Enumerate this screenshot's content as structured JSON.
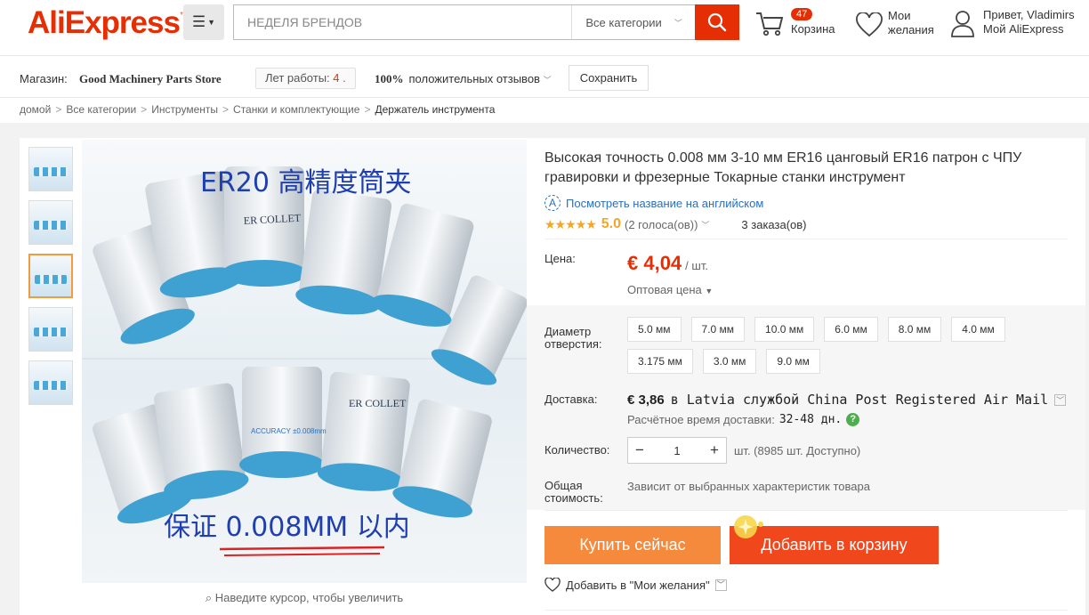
{
  "header": {
    "logo": "AliExpress",
    "logo_tm": "™",
    "search_placeholder": "НЕДЕЛЯ БРЕНДОВ",
    "category": "Все категории",
    "cart_count": "47",
    "cart_label": "Корзина",
    "wishlist_line1": "Мои",
    "wishlist_line2": "желания",
    "greeting": "Привет, Vladimirs",
    "my_account": "Мой AliExpress"
  },
  "store": {
    "label": "Магазин:",
    "name": "Good Machinery Parts Store",
    "years_label": "Лет работы:",
    "years_value": "4 .",
    "positive_percent": "100%",
    "positive_label": "положительных отзывов",
    "save_label": "Сохранить"
  },
  "breadcrumb": [
    "домой",
    "Все категории",
    "Инструменты",
    "Станки и комплектующие",
    "Держатель инструмента"
  ],
  "gallery": {
    "zoom_hint": "Наведите курсор, чтобы увеличить",
    "top_text": "ER20 高精度筒夹",
    "bottom_text": "保证 0.008MM 以内",
    "collet_label": "ER COLLET",
    "accuracy": "ACCURACY ±0.008mm"
  },
  "product": {
    "title": "Высокая точность 0.008 мм 3-10 мм ER16 цанговый ER16 патрон с ЧПУ гравировки и фрезерные Токарные станки инструмент",
    "translate_link": "Посмотреть название на английском",
    "rating_score": "5.0",
    "votes": "(2 голоса(ов))",
    "orders": "3 заказа(ов)",
    "price_label": "Цена:",
    "price": "€ 4,04",
    "price_unit": "/ шт.",
    "wholesale": "Оптовая цена",
    "hole_label_1": "Диаметр",
    "hole_label_2": "отверстия:",
    "options": [
      "5.0 мм",
      "7.0 мм",
      "10.0 мм",
      "6.0 мм",
      "8.0 мм",
      "4.0 мм",
      "3.175 мм",
      "3.0 мм",
      "9.0 мм"
    ],
    "shipping_label": "Доставка:",
    "shipping_price": "€ 3,86",
    "shipping_text": "в Latvia службой China Post Registered Air Mail",
    "delivery_time_label": "Расчётное время доставки:",
    "delivery_days": "32-48 дн.",
    "qty_label": "Количество:",
    "qty_value": "1",
    "available": "шт. (8985 шт. Доступно)",
    "total_label_1": "Общая",
    "total_label_2": "стоимость:",
    "total_text": "Зависит от выбранных характеристик товара",
    "buy_now": "Купить сейчас",
    "add_to_cart": "Добавить в корзину",
    "add_wishlist": "Добавить в \"Мои желания\""
  },
  "colors": {
    "brand": "#e62e04",
    "buy": "#f58a3c",
    "cart_btn": "#f0471c",
    "star": "#f5a623",
    "link": "#2a6fbf"
  }
}
